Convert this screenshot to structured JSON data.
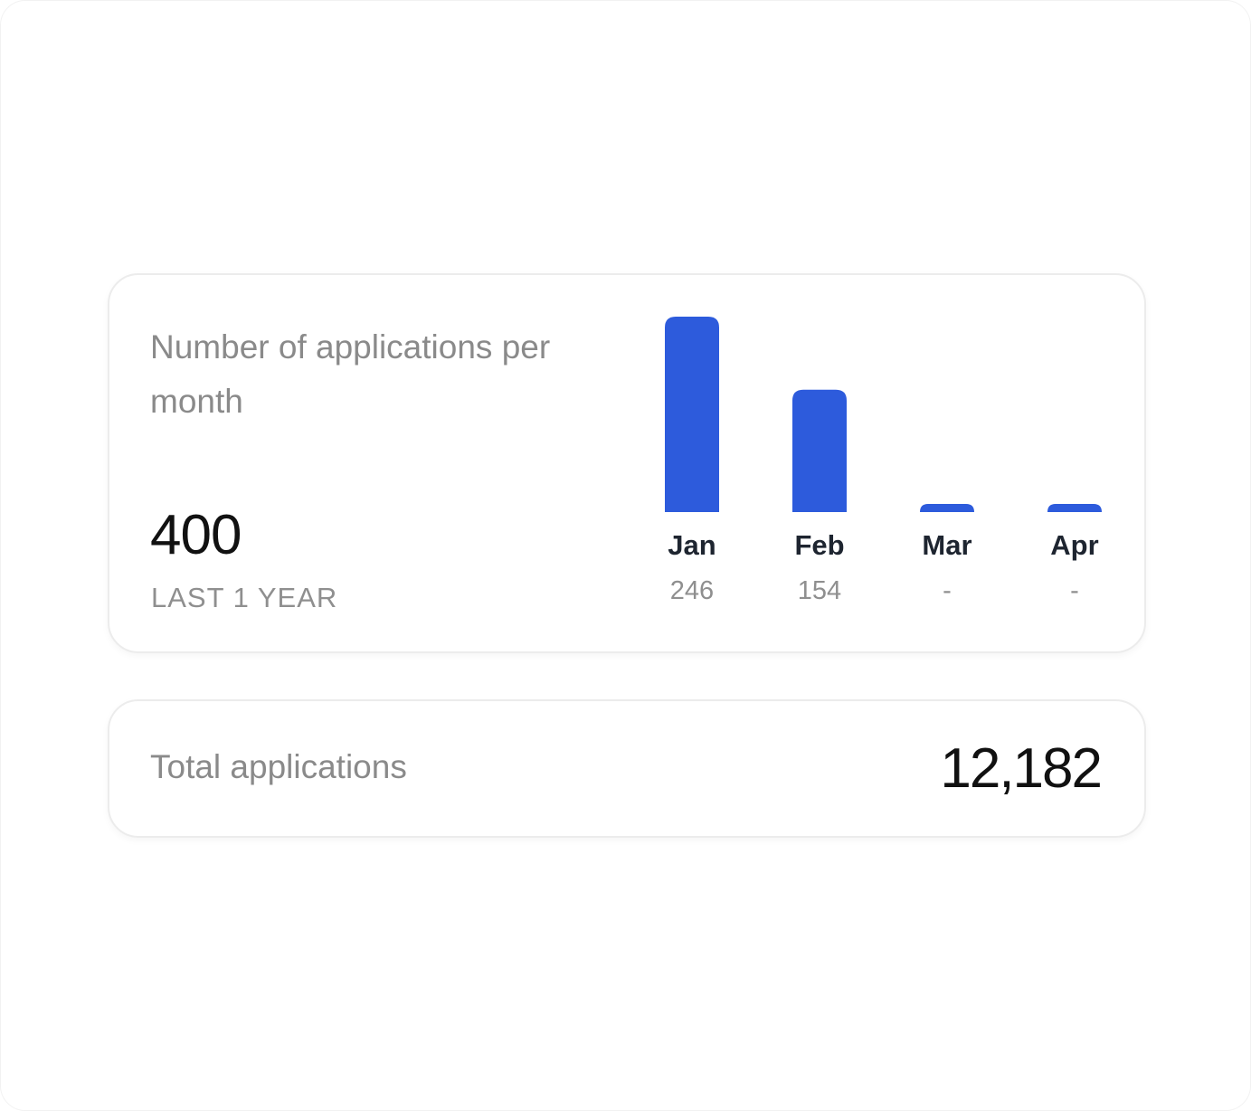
{
  "card": {
    "title": "Number of applications per month",
    "value": "400",
    "period": "LAST 1 YEAR"
  },
  "total": {
    "label": "Total applications",
    "value": "12,182"
  },
  "colors": {
    "bar": "#2d5bdc",
    "text_primary": "#111111",
    "text_secondary": "#8a8a8a"
  },
  "chart_data": {
    "type": "bar",
    "categories": [
      "Jan",
      "Feb",
      "Mar",
      "Apr"
    ],
    "values": [
      246,
      154,
      0,
      0
    ],
    "value_labels": [
      "246",
      "154",
      "-",
      "-"
    ],
    "title": "Number of applications per month",
    "ylim": [
      0,
      246
    ],
    "grid": false,
    "legend": "none"
  }
}
